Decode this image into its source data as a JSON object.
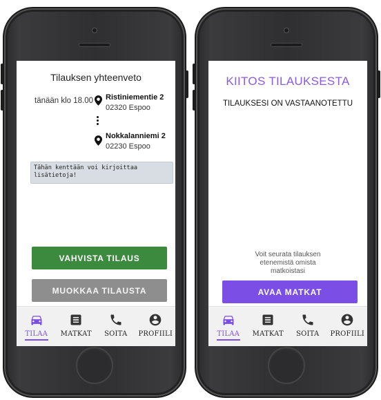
{
  "left_phone": {
    "summary_title": "Tilauksen yhteenveto",
    "pickup_time": "tänään klo 18.00",
    "pickup": {
      "street": "Ristiniementie 2",
      "city": "02320 Espoo"
    },
    "dropoff": {
      "street": "Nokkalanniemi 2",
      "city": "02230 Espoo"
    },
    "notes_value": "Tähän kenttään voi kirjoittaa lisätietoja!",
    "confirm_label": "VAHVISTA TILAUS",
    "edit_label": "MUOKKAA TILAUSTA"
  },
  "right_phone": {
    "thanks_title": "KIITOS TILAUKSESTA",
    "received_text": "TILAUKSESI ON VASTAANOTETTU",
    "follow_lines": [
      "Voit seurata tilauksen",
      "etenemistä omista",
      "matkoistasi"
    ],
    "open_trips_label": "AVAA MATKAT"
  },
  "nav": {
    "items": [
      {
        "label": "TILAA",
        "icon": "car-icon",
        "active": true
      },
      {
        "label": "MATKAT",
        "icon": "list-icon",
        "active": false
      },
      {
        "label": "SOITA",
        "icon": "phone-icon",
        "active": false
      },
      {
        "label": "PROFIILI",
        "icon": "account-icon",
        "active": false
      }
    ]
  },
  "colors": {
    "accent": "#7b4fe6",
    "confirm_green": "#3b8a3e",
    "edit_gray": "#8e8e8e",
    "title_purple": "#8a5be0"
  }
}
